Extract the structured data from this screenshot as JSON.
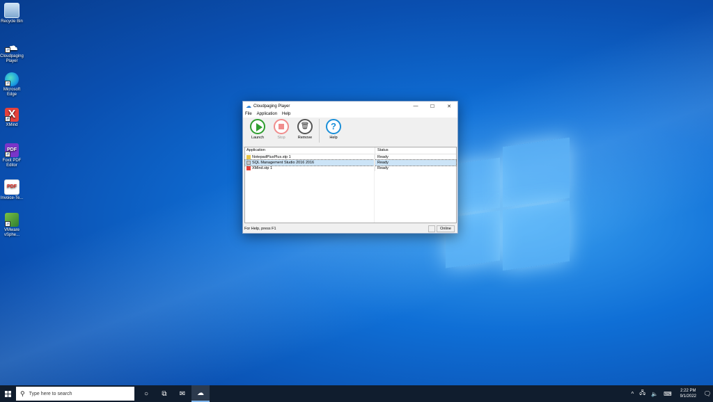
{
  "desktop": {
    "icons": [
      {
        "label": "Recycle Bin",
        "icon": "recycle-bin-icon"
      },
      {
        "label": "Cloudpaging Player",
        "icon": "cloud-icon"
      },
      {
        "label": "Microsoft Edge",
        "icon": "edge-icon"
      },
      {
        "label": "XMind",
        "icon": "xmind-icon"
      },
      {
        "label": "Foxit PDF Editor",
        "icon": "foxit-icon"
      },
      {
        "label": "Invoice-Te...",
        "icon": "pdf-icon"
      },
      {
        "label": "VMware vSphe...",
        "icon": "vmware-icon"
      }
    ],
    "icon_pdf_text": "PDF",
    "icon_xmind_text": "X"
  },
  "window": {
    "title": "Cloudpaging Player",
    "controls": {
      "minimize": "—",
      "maximize": "☐",
      "close": "✕"
    },
    "menu": [
      "File",
      "Application",
      "Help"
    ],
    "toolbar": {
      "launch": "Launch",
      "stop": "Stop",
      "remove": "Remove",
      "help": "Help",
      "help_glyph": "?",
      "remove_glyph": "🗑"
    },
    "list": {
      "columns": [
        "Application",
        "Status"
      ],
      "rows": [
        {
          "name": "NotepadPlusPlus.stp 1",
          "status": "Ready"
        },
        {
          "name": "SQL Management Studio 2016 2016",
          "status": "Ready"
        },
        {
          "name": "XMind.stp 1",
          "status": "Ready"
        }
      ]
    },
    "statusbar": {
      "text": "For Help, press F1",
      "state": "Online"
    }
  },
  "taskbar": {
    "search_placeholder": "Type here to search",
    "clock_time": "2:22 PM",
    "clock_date": "9/1/2022"
  }
}
